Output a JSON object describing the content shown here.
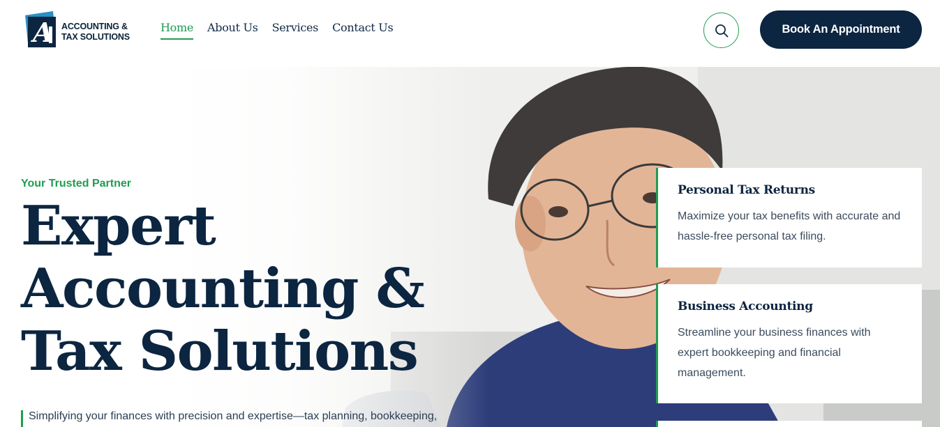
{
  "brand": {
    "line1": "ACCOUNTING &",
    "line2": "TAX SOLUTIONS",
    "colors": {
      "navy": "#0c2540",
      "green": "#1f9d4f",
      "logo_blue": "#2a8fc4"
    }
  },
  "nav": {
    "items": [
      {
        "label": "Home",
        "active": true
      },
      {
        "label": "About Us",
        "active": false
      },
      {
        "label": "Services",
        "active": false
      },
      {
        "label": "Contact Us",
        "active": false
      }
    ]
  },
  "header": {
    "search_icon": "search-icon",
    "book_label": "Book An Appointment"
  },
  "hero": {
    "eyebrow": "Your Trusted Partner",
    "headline": [
      "Expert",
      "Accounting &",
      "Tax Solutions"
    ],
    "intro": "Simplifying your finances with precision and expertise—tax planning, bookkeeping,"
  },
  "services": [
    {
      "title": "Personal Tax Returns",
      "description": "Maximize your tax benefits with accurate and hassle-free personal tax filing."
    },
    {
      "title": "Business Accounting",
      "description": "Streamline your business finances with expert bookkeeping and financial management."
    }
  ]
}
